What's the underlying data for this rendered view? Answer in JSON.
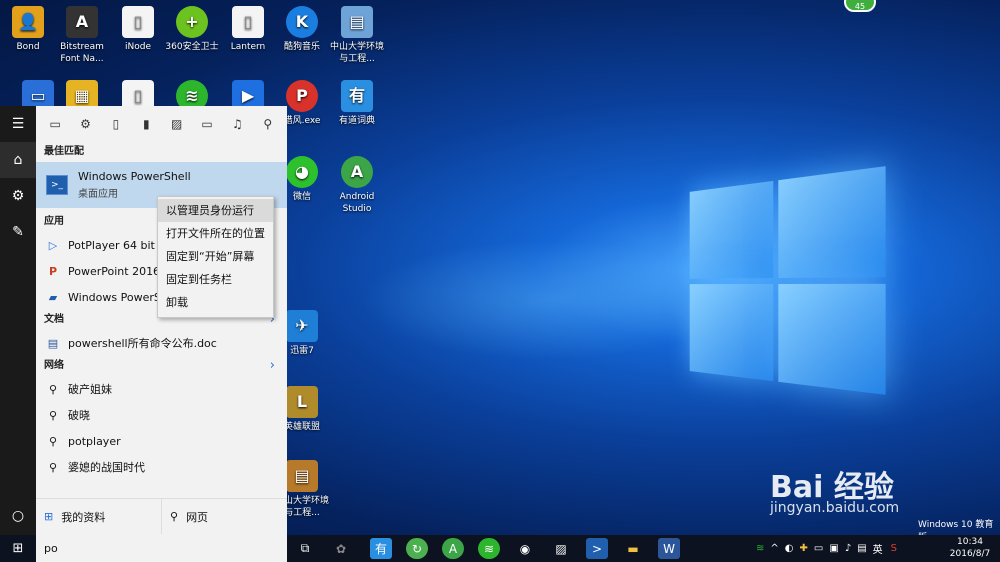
{
  "desktop": {
    "icons": [
      {
        "label": "Bond"
      },
      {
        "label": "Bitstream Font Na..."
      },
      {
        "label": "iNode"
      },
      {
        "label": "360安全卫士"
      },
      {
        "label": "Lantern"
      },
      {
        "label": "酷狗音乐"
      },
      {
        "label": "中山大学环境与工程..."
      },
      {
        "label": "猎风.exe"
      },
      {
        "label": "有道词典"
      },
      {
        "label": "微信"
      },
      {
        "label": "Android Studio"
      },
      {
        "label": "迅雷7"
      },
      {
        "label": "英雄联盟"
      },
      {
        "label": "中山大学环境与工程..."
      }
    ],
    "notification_badge": "45",
    "watermark": "Windows 10 教育版",
    "baidu_logo": "Bai 经验",
    "baidu_url": "jingyan.baidu.com"
  },
  "start_rail": {
    "items": [
      {
        "icon": "hamburger-icon"
      },
      {
        "icon": "home-icon"
      },
      {
        "icon": "gear-icon"
      },
      {
        "icon": "feedback-icon"
      },
      {
        "icon": "power-icon"
      }
    ]
  },
  "search_panel": {
    "filter_icons": [
      "apps-icon",
      "settings-icon",
      "document-icon",
      "tablet-icon",
      "photo-icon",
      "video-icon",
      "music-icon",
      "search-icon"
    ],
    "best_match_header": "最佳匹配",
    "best_match": {
      "title": "Windows PowerShell",
      "subtitle": "桌面应用"
    },
    "apps_header": "应用",
    "apps": [
      {
        "label": "PotPlayer 64 bit"
      },
      {
        "label": "PowerPoint 2016"
      },
      {
        "label": "Windows PowerS"
      }
    ],
    "docs_header": "文档",
    "docs": [
      {
        "label": "powershell所有命令公布.doc"
      }
    ],
    "web_header": "网络",
    "web": [
      {
        "label": "破产姐妹"
      },
      {
        "label": "破晓"
      },
      {
        "label": "potplayer"
      },
      {
        "label": "婆媳的战国时代"
      }
    ],
    "bottom": {
      "my_stuff": "我的资料",
      "web": "网页"
    }
  },
  "context_menu": {
    "items": [
      {
        "label": "以管理员身份运行"
      },
      {
        "label": "打开文件所在的位置"
      },
      {
        "label": "固定到“开始”屏幕"
      },
      {
        "label": "固定到任务栏"
      },
      {
        "label": "卸载"
      }
    ]
  },
  "taskbar": {
    "search_value": "po",
    "tray_ime": "英",
    "clock_time": "10:34",
    "clock_date": "2016/8/7"
  },
  "colors": {
    "accent": "#2a6fd8",
    "selection": "#c0d8ee",
    "taskbar": "#0c1220"
  }
}
